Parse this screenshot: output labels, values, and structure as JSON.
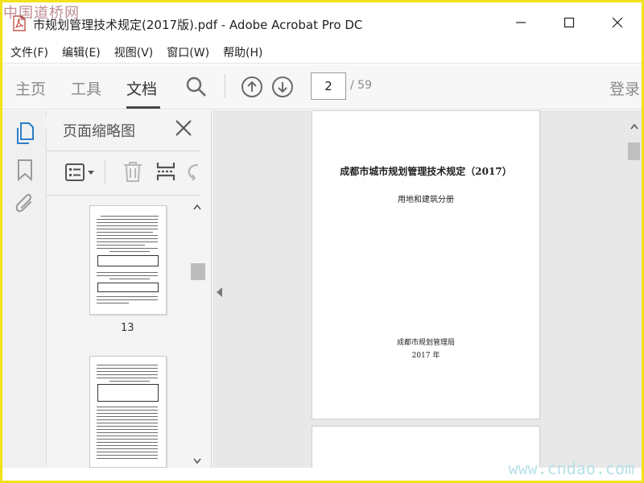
{
  "watermark": {
    "top": "中国道桥网",
    "bottom": "www.cndao.com"
  },
  "titlebar": {
    "title": "市规划管理技术规定(2017版).pdf - Adobe Acrobat Pro DC",
    "icon": "pdf-file-icon",
    "min_glyph": "—",
    "max_glyph": "☐",
    "close_glyph": "✕"
  },
  "menu": {
    "items": [
      {
        "label": "文件(F)"
      },
      {
        "label": "编辑(E)"
      },
      {
        "label": "视图(V)"
      },
      {
        "label": "窗口(W)"
      },
      {
        "label": "帮助(H)"
      }
    ]
  },
  "toolbar": {
    "tabs": [
      "主页",
      "工具",
      "文档"
    ],
    "active_tab": "文档",
    "search_icon": "search-icon",
    "prev_icon": "arrow-up-circle-icon",
    "next_icon": "arrow-down-circle-icon",
    "current_page": "2",
    "total_pages": "/ 59",
    "login": "登录"
  },
  "rail": {
    "icons": [
      "page-thumbnails-icon",
      "bookmark-icon",
      "attachment-icon"
    ],
    "accent": "#2d7ec8"
  },
  "thumbnail_panel": {
    "title": "页面缩略图",
    "tools": [
      "thumbnail-options-icon",
      "delete-page-icon",
      "insert-page-icon",
      "rotate-page-icon"
    ],
    "pages": [
      {
        "number": "13"
      },
      {
        "number": ""
      }
    ]
  },
  "document": {
    "page1": {
      "title": "成都市城市规划管理技术规定（2017）",
      "subtitle": "用地和建筑分册",
      "organization": "成都市规划管理局",
      "year": "2017 年"
    }
  }
}
